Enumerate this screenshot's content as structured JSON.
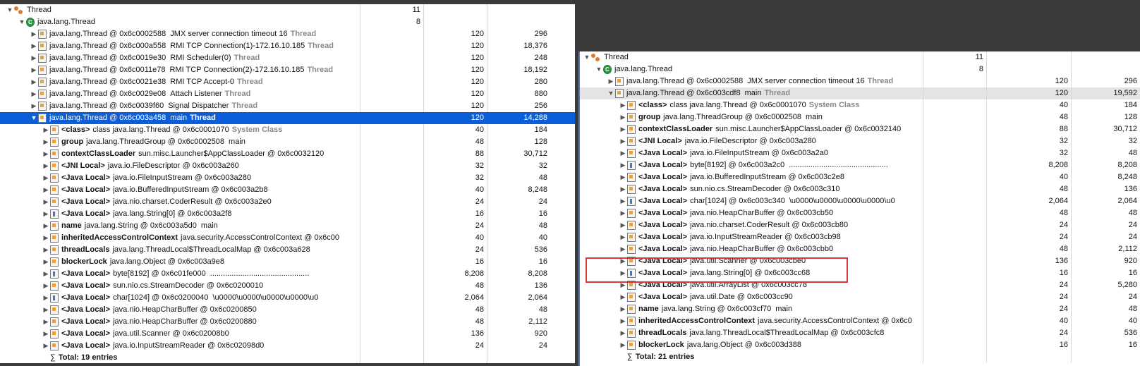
{
  "left_pane": {
    "rows": [
      {
        "depth": 0,
        "twisty": "▼",
        "icon": "group",
        "pfx": "",
        "name": "Thread",
        "suffix": "",
        "kw": "",
        "c1": "11",
        "c2": "",
        "c3": ""
      },
      {
        "depth": 1,
        "twisty": "▼",
        "icon": "class",
        "pfx": "",
        "name": "java.lang.Thread",
        "suffix": "",
        "kw": "",
        "c1": "8",
        "c2": "",
        "c3": ""
      },
      {
        "depth": 2,
        "twisty": "▶",
        "icon": "obj",
        "pfx": "",
        "name": "java.lang.Thread @ 0x6c0002588",
        "suffix": "JMX server connection timeout 16",
        "kw": "Thread",
        "c1": "",
        "c2": "120",
        "c3": "296"
      },
      {
        "depth": 2,
        "twisty": "▶",
        "icon": "obj",
        "pfx": "",
        "name": "java.lang.Thread @ 0x6c000a558",
        "suffix": "RMI TCP Connection(1)-172.16.10.185",
        "kw": "Thread",
        "c1": "",
        "c2": "120",
        "c3": "18,376"
      },
      {
        "depth": 2,
        "twisty": "▶",
        "icon": "obj",
        "pfx": "",
        "name": "java.lang.Thread @ 0x6c0019e30",
        "suffix": "RMI Scheduler(0)",
        "kw": "Thread",
        "c1": "",
        "c2": "120",
        "c3": "248"
      },
      {
        "depth": 2,
        "twisty": "▶",
        "icon": "obj",
        "pfx": "",
        "name": "java.lang.Thread @ 0x6c0011e78",
        "suffix": "RMI TCP Connection(2)-172.16.10.185",
        "kw": "Thread",
        "c1": "",
        "c2": "120",
        "c3": "18,192"
      },
      {
        "depth": 2,
        "twisty": "▶",
        "icon": "obj",
        "pfx": "",
        "name": "java.lang.Thread @ 0x6c0021e38",
        "suffix": "RMI TCP Accept-0",
        "kw": "Thread",
        "c1": "",
        "c2": "120",
        "c3": "280"
      },
      {
        "depth": 2,
        "twisty": "▶",
        "icon": "obj",
        "pfx": "",
        "name": "java.lang.Thread @ 0x6c0029e08",
        "suffix": "Attach Listener",
        "kw": "Thread",
        "c1": "",
        "c2": "120",
        "c3": "880"
      },
      {
        "depth": 2,
        "twisty": "▶",
        "icon": "obj",
        "pfx": "",
        "name": "java.lang.Thread @ 0x6c0039f60",
        "suffix": "Signal Dispatcher",
        "kw": "Thread",
        "c1": "",
        "c2": "120",
        "c3": "256"
      },
      {
        "depth": 2,
        "twisty": "▼",
        "icon": "obj",
        "pfx": "",
        "name": "java.lang.Thread @ 0x6c003a458",
        "suffix": "main",
        "kw": "Thread",
        "c1": "",
        "c2": "120",
        "c3": "14,288",
        "selected": true
      },
      {
        "depth": 3,
        "twisty": "▶",
        "icon": "obj",
        "pfx": "<class>",
        "name": "class java.lang.Thread @ 0x6c0001070",
        "suffix": "",
        "kw": "System Class",
        "c1": "",
        "c2": "40",
        "c3": "184"
      },
      {
        "depth": 3,
        "twisty": "▶",
        "icon": "obj",
        "pfx": "group",
        "name": "java.lang.ThreadGroup @ 0x6c0002508",
        "suffix": "main",
        "kw": "",
        "c1": "",
        "c2": "48",
        "c3": "128"
      },
      {
        "depth": 3,
        "twisty": "▶",
        "icon": "obj",
        "pfx": "contextClassLoader",
        "name": "sun.misc.Launcher$AppClassLoader @ 0x6c0032120",
        "suffix": "",
        "kw": "",
        "c1": "",
        "c2": "88",
        "c3": "30,712"
      },
      {
        "depth": 3,
        "twisty": "▶",
        "icon": "obj",
        "pfx": "<JNI Local>",
        "name": "java.io.FileDescriptor @ 0x6c003a260",
        "suffix": "",
        "kw": "",
        "c1": "",
        "c2": "32",
        "c3": "32"
      },
      {
        "depth": 3,
        "twisty": "▶",
        "icon": "obj",
        "pfx": "<Java Local>",
        "name": "java.io.FileInputStream @ 0x6c003a280",
        "suffix": "",
        "kw": "",
        "c1": "",
        "c2": "32",
        "c3": "48"
      },
      {
        "depth": 3,
        "twisty": "▶",
        "icon": "obj",
        "pfx": "<Java Local>",
        "name": "java.io.BufferedInputStream @ 0x6c003a2b8",
        "suffix": "",
        "kw": "",
        "c1": "",
        "c2": "40",
        "c3": "8,248"
      },
      {
        "depth": 3,
        "twisty": "▶",
        "icon": "obj",
        "pfx": "<Java Local>",
        "name": "java.nio.charset.CoderResult @ 0x6c003a2e0",
        "suffix": "",
        "kw": "",
        "c1": "",
        "c2": "24",
        "c3": "24"
      },
      {
        "depth": 3,
        "twisty": "▶",
        "icon": "arr",
        "pfx": "<Java Local>",
        "name": "java.lang.String[0] @ 0x6c003a2f8",
        "suffix": "",
        "kw": "",
        "c1": "",
        "c2": "16",
        "c3": "16"
      },
      {
        "depth": 3,
        "twisty": "▶",
        "icon": "obj",
        "pfx": "name",
        "name": "java.lang.String @ 0x6c003a5d0",
        "suffix": "main",
        "kw": "",
        "c1": "",
        "c2": "24",
        "c3": "48"
      },
      {
        "depth": 3,
        "twisty": "▶",
        "icon": "obj",
        "pfx": "inheritedAccessControlContext",
        "name": "java.security.AccessControlContext @ 0x6c00",
        "suffix": "",
        "kw": "",
        "c1": "",
        "c2": "40",
        "c3": "40"
      },
      {
        "depth": 3,
        "twisty": "▶",
        "icon": "obj",
        "pfx": "threadLocals",
        "name": "java.lang.ThreadLocal$ThreadLocalMap @ 0x6c003a628",
        "suffix": "",
        "kw": "",
        "c1": "",
        "c2": "24",
        "c3": "536"
      },
      {
        "depth": 3,
        "twisty": "▶",
        "icon": "obj",
        "pfx": "blockerLock",
        "name": "java.lang.Object @ 0x6c003a9e8",
        "suffix": "",
        "kw": "",
        "c1": "",
        "c2": "16",
        "c3": "16"
      },
      {
        "depth": 3,
        "twisty": "▶",
        "icon": "arr",
        "pfx": "<Java Local>",
        "name": "byte[8192] @ 0x6c01fe000",
        "suffix": "..............................................",
        "kw": "",
        "c1": "",
        "c2": "8,208",
        "c3": "8,208"
      },
      {
        "depth": 3,
        "twisty": "▶",
        "icon": "obj",
        "pfx": "<Java Local>",
        "name": "sun.nio.cs.StreamDecoder @ 0x6c0200010",
        "suffix": "",
        "kw": "",
        "c1": "",
        "c2": "48",
        "c3": "136"
      },
      {
        "depth": 3,
        "twisty": "▶",
        "icon": "arr",
        "pfx": "<Java Local>",
        "name": "char[1024] @ 0x6c0200040",
        "suffix": "\\u0000\\u0000\\u0000\\u0000\\u0",
        "kw": "",
        "c1": "",
        "c2": "2,064",
        "c3": "2,064"
      },
      {
        "depth": 3,
        "twisty": "▶",
        "icon": "obj",
        "pfx": "<Java Local>",
        "name": "java.nio.HeapCharBuffer @ 0x6c0200850",
        "suffix": "",
        "kw": "",
        "c1": "",
        "c2": "48",
        "c3": "48"
      },
      {
        "depth": 3,
        "twisty": "▶",
        "icon": "obj",
        "pfx": "<Java Local>",
        "name": "java.nio.HeapCharBuffer @ 0x6c0200880",
        "suffix": "",
        "kw": "",
        "c1": "",
        "c2": "48",
        "c3": "2,112"
      },
      {
        "depth": 3,
        "twisty": "▶",
        "icon": "obj",
        "pfx": "<Java Local>",
        "name": "java.util.Scanner @ 0x6c02008b0",
        "suffix": "",
        "kw": "",
        "c1": "",
        "c2": "136",
        "c3": "920"
      },
      {
        "depth": 3,
        "twisty": "▶",
        "icon": "obj",
        "pfx": "<Java Local>",
        "name": "java.io.InputStreamReader @ 0x6c02098d0",
        "suffix": "",
        "kw": "",
        "c1": "",
        "c2": "24",
        "c3": "24"
      }
    ],
    "total": "Total: 19 entries"
  },
  "right_pane": {
    "rows": [
      {
        "depth": 0,
        "twisty": "▼",
        "icon": "group",
        "pfx": "",
        "name": "Thread",
        "suffix": "",
        "kw": "",
        "c1": "11",
        "c2": "",
        "c3": ""
      },
      {
        "depth": 1,
        "twisty": "▼",
        "icon": "class",
        "pfx": "",
        "name": "java.lang.Thread",
        "suffix": "",
        "kw": "",
        "c1": "8",
        "c2": "",
        "c3": ""
      },
      {
        "depth": 2,
        "twisty": "▶",
        "icon": "obj",
        "pfx": "",
        "name": "java.lang.Thread @ 0x6c0002588",
        "suffix": "JMX server connection timeout 16",
        "kw": "Thread",
        "c1": "",
        "c2": "120",
        "c3": "296"
      },
      {
        "depth": 2,
        "twisty": "▼",
        "icon": "obj",
        "pfx": "",
        "name": "java.lang.Thread @ 0x6c003cdf8",
        "suffix": "main",
        "kw": "Thread",
        "c1": "",
        "c2": "120",
        "c3": "19,592",
        "highlight": true
      },
      {
        "depth": 3,
        "twisty": "▶",
        "icon": "obj",
        "pfx": "<class>",
        "name": "class java.lang.Thread @ 0x6c0001070",
        "suffix": "",
        "kw": "System Class",
        "c1": "",
        "c2": "40",
        "c3": "184"
      },
      {
        "depth": 3,
        "twisty": "▶",
        "icon": "obj",
        "pfx": "group",
        "name": "java.lang.ThreadGroup @ 0x6c0002508",
        "suffix": "main",
        "kw": "",
        "c1": "",
        "c2": "48",
        "c3": "128"
      },
      {
        "depth": 3,
        "twisty": "▶",
        "icon": "obj",
        "pfx": "contextClassLoader",
        "name": "sun.misc.Launcher$AppClassLoader @ 0x6c0032140",
        "suffix": "",
        "kw": "",
        "c1": "",
        "c2": "88",
        "c3": "30,712"
      },
      {
        "depth": 3,
        "twisty": "▶",
        "icon": "obj",
        "pfx": "<JNI Local>",
        "name": "java.io.FileDescriptor @ 0x6c003a280",
        "suffix": "",
        "kw": "",
        "c1": "",
        "c2": "32",
        "c3": "32"
      },
      {
        "depth": 3,
        "twisty": "▶",
        "icon": "obj",
        "pfx": "<Java Local>",
        "name": "java.io.FileInputStream @ 0x6c003a2a0",
        "suffix": "",
        "kw": "",
        "c1": "",
        "c2": "32",
        "c3": "48"
      },
      {
        "depth": 3,
        "twisty": "▶",
        "icon": "arr",
        "pfx": "<Java Local>",
        "name": "byte[8192] @ 0x6c003a2c0",
        "suffix": "..............................................",
        "kw": "",
        "c1": "",
        "c2": "8,208",
        "c3": "8,208"
      },
      {
        "depth": 3,
        "twisty": "▶",
        "icon": "obj",
        "pfx": "<Java Local>",
        "name": "java.io.BufferedInputStream @ 0x6c003c2e8",
        "suffix": "",
        "kw": "",
        "c1": "",
        "c2": "40",
        "c3": "8,248"
      },
      {
        "depth": 3,
        "twisty": "▶",
        "icon": "obj",
        "pfx": "<Java Local>",
        "name": "sun.nio.cs.StreamDecoder @ 0x6c003c310",
        "suffix": "",
        "kw": "",
        "c1": "",
        "c2": "48",
        "c3": "136"
      },
      {
        "depth": 3,
        "twisty": "▶",
        "icon": "arr",
        "pfx": "<Java Local>",
        "name": "char[1024] @ 0x6c003c340",
        "suffix": "\\u0000\\u0000\\u0000\\u0000\\u0",
        "kw": "",
        "c1": "",
        "c2": "2,064",
        "c3": "2,064"
      },
      {
        "depth": 3,
        "twisty": "▶",
        "icon": "obj",
        "pfx": "<Java Local>",
        "name": "java.nio.HeapCharBuffer @ 0x6c003cb50",
        "suffix": "",
        "kw": "",
        "c1": "",
        "c2": "48",
        "c3": "48"
      },
      {
        "depth": 3,
        "twisty": "▶",
        "icon": "obj",
        "pfx": "<Java Local>",
        "name": "java.nio.charset.CoderResult @ 0x6c003cb80",
        "suffix": "",
        "kw": "",
        "c1": "",
        "c2": "24",
        "c3": "24"
      },
      {
        "depth": 3,
        "twisty": "▶",
        "icon": "obj",
        "pfx": "<Java Local>",
        "name": "java.io.InputStreamReader @ 0x6c003cb98",
        "suffix": "",
        "kw": "",
        "c1": "",
        "c2": "24",
        "c3": "24"
      },
      {
        "depth": 3,
        "twisty": "▶",
        "icon": "obj",
        "pfx": "<Java Local>",
        "name": "java.nio.HeapCharBuffer @ 0x6c003cbb0",
        "suffix": "",
        "kw": "",
        "c1": "",
        "c2": "48",
        "c3": "2,112"
      },
      {
        "depth": 3,
        "twisty": "▶",
        "icon": "obj",
        "pfx": "<Java Local>",
        "name": "java.util.Scanner @ 0x6c003cbe0",
        "suffix": "",
        "kw": "",
        "c1": "",
        "c2": "136",
        "c3": "920"
      },
      {
        "depth": 3,
        "twisty": "▶",
        "icon": "arr",
        "pfx": "<Java Local>",
        "name": "java.lang.String[0] @ 0x6c003cc68",
        "suffix": "",
        "kw": "",
        "c1": "",
        "c2": "16",
        "c3": "16"
      },
      {
        "depth": 3,
        "twisty": "▶",
        "icon": "obj",
        "pfx": "<Java Local>",
        "name": "java.util.ArrayList @ 0x6c003cc78",
        "suffix": "",
        "kw": "",
        "c1": "",
        "c2": "24",
        "c3": "5,280"
      },
      {
        "depth": 3,
        "twisty": "▶",
        "icon": "obj",
        "pfx": "<Java Local>",
        "name": "java.util.Date @ 0x6c003cc90",
        "suffix": "",
        "kw": "",
        "c1": "",
        "c2": "24",
        "c3": "24"
      },
      {
        "depth": 3,
        "twisty": "▶",
        "icon": "obj",
        "pfx": "name",
        "name": "java.lang.String @ 0x6c003cf70",
        "suffix": "main",
        "kw": "",
        "c1": "",
        "c2": "24",
        "c3": "48"
      },
      {
        "depth": 3,
        "twisty": "▶",
        "icon": "obj",
        "pfx": "inheritedAccessControlContext",
        "name": "java.security.AccessControlContext @ 0x6c0",
        "suffix": "",
        "kw": "",
        "c1": "",
        "c2": "40",
        "c3": "40"
      },
      {
        "depth": 3,
        "twisty": "▶",
        "icon": "obj",
        "pfx": "threadLocals",
        "name": "java.lang.ThreadLocal$ThreadLocalMap @ 0x6c003cfc8",
        "suffix": "",
        "kw": "",
        "c1": "",
        "c2": "24",
        "c3": "536"
      },
      {
        "depth": 3,
        "twisty": "▶",
        "icon": "obj",
        "pfx": "blockerLock",
        "name": "java.lang.Object @ 0x6c003d388",
        "suffix": "",
        "kw": "",
        "c1": "",
        "c2": "16",
        "c3": "16"
      }
    ],
    "total": "Total: 21 entries"
  },
  "colors": {
    "selection": "#0b5ed7",
    "highlight_row": "#e4e4e4",
    "annotation_box": "#d63a3a"
  }
}
